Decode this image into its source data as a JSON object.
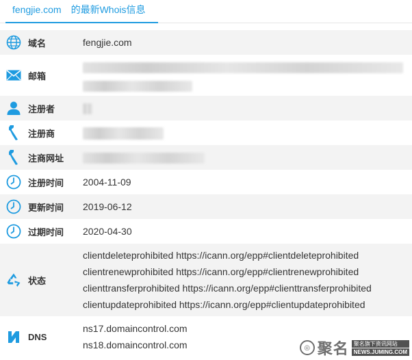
{
  "tab": {
    "domain": "fengjie.com",
    "title": "的最新Whois信息"
  },
  "rows": [
    {
      "icon": "globe-icon",
      "label": "域名",
      "values": [
        "fengjie.com"
      ]
    },
    {
      "icon": "envelope-icon",
      "label": "邮箱",
      "values": []
    },
    {
      "icon": "user-icon",
      "label": "注册者",
      "values": []
    },
    {
      "icon": "wrench-icon",
      "label": "注册商",
      "values": []
    },
    {
      "icon": "wrench-icon",
      "label": "注商网址",
      "values": []
    },
    {
      "icon": "clock-icon",
      "label": "注册时间",
      "values": [
        "2004-11-09"
      ]
    },
    {
      "icon": "clock-icon",
      "label": "更新时间",
      "values": [
        "2019-06-12"
      ]
    },
    {
      "icon": "clock-icon",
      "label": "过期时间",
      "values": [
        "2020-04-30"
      ]
    },
    {
      "icon": "recycle-icon",
      "label": "状态",
      "values": [
        "clientdeleteprohibited https://icann.org/epp#clientdeleteprohibited",
        "clientrenewprohibited https://icann.org/epp#clientrenewprohibited",
        "clienttransferprohibited https://icann.org/epp#clienttransferprohibited",
        "clientupdateprohibited https://icann.org/epp#clientupdateprohibited"
      ]
    },
    {
      "icon": "dns-icon",
      "label": "DNS",
      "values": [
        "ns17.domaincontrol.com",
        "ns18.domaincontrol.com"
      ]
    }
  ],
  "watermark": {
    "name": "聚名",
    "line1": "聚名旗下资讯网站",
    "line2": "NEWS.JUMING.COM"
  },
  "colors": {
    "accent": "#1e9be0",
    "row_alt": "#f3f3f3"
  }
}
